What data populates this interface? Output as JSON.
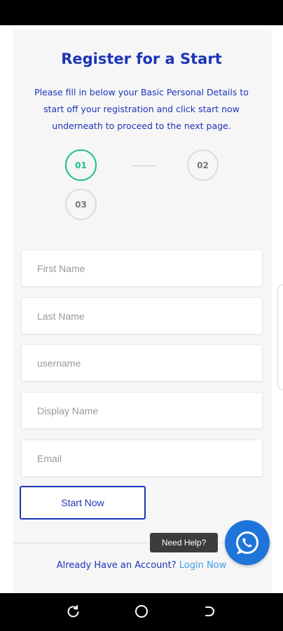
{
  "header": {
    "title": "Register for a Start",
    "subtitle": "Please fill in below your Basic Personal Details to start off your registration and click start now underneath to proceed to the next page."
  },
  "steps": [
    {
      "label": "01",
      "active": true
    },
    {
      "label": "02",
      "active": false
    },
    {
      "label": "03",
      "active": false
    }
  ],
  "form": {
    "first_name_placeholder": "First Name",
    "last_name_placeholder": "Last Name",
    "username_placeholder": "username",
    "display_name_placeholder": "Display Name",
    "email_placeholder": "Email",
    "start_label": "Start Now"
  },
  "footer": {
    "login_prompt": "Already Have an Account? ",
    "login_link": "Login Now"
  },
  "help": {
    "label": "Need Help?",
    "icon": "whatsapp-icon"
  },
  "colors": {
    "accent": "#1d34b7",
    "active_step": "#19c37d",
    "link": "#3aa0e6",
    "whatsapp_button": "#1e74d9"
  }
}
